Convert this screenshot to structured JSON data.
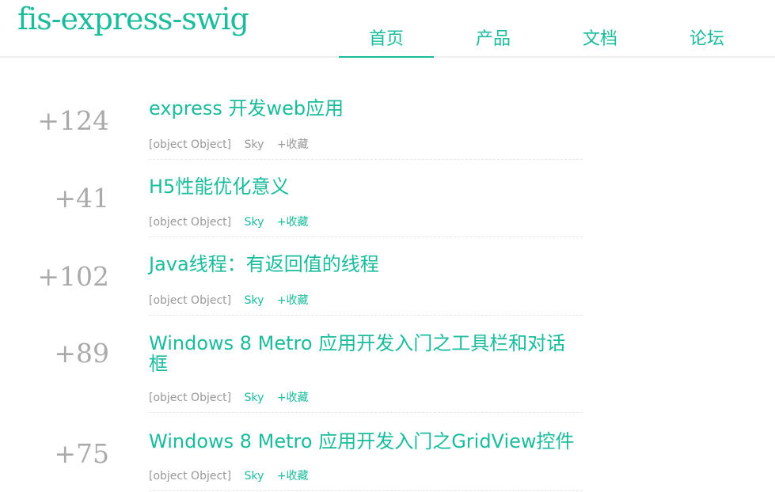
{
  "site": {
    "logo": "fis-express-swig"
  },
  "nav": {
    "items": [
      {
        "label": "首页"
      },
      {
        "label": "产品"
      },
      {
        "label": "文档"
      },
      {
        "label": "论坛"
      }
    ],
    "active_index": 0
  },
  "posts": [
    {
      "score": "+124",
      "title": "express 开发web应用",
      "category": "[object Object]",
      "author": "Sky",
      "fav": "+收藏"
    },
    {
      "score": "+41",
      "title": "H5性能优化意义",
      "category": "[object Object]",
      "author": "Sky",
      "fav": "+收藏"
    },
    {
      "score": "+102",
      "title": "Java线程：有返回值的线程",
      "category": "[object Object]",
      "author": "Sky",
      "fav": "+收藏"
    },
    {
      "score": "+89",
      "title": "Windows 8 Metro 应用开发入门之工具栏和对话框",
      "category": "[object Object]",
      "author": "Sky",
      "fav": "+收藏"
    },
    {
      "score": "+75",
      "title": "Windows 8 Metro 应用开发入门之GridView控件",
      "category": "[object Object]",
      "author": "Sky",
      "fav": "+收藏"
    }
  ],
  "colors": {
    "accent": "#1abc9c",
    "muted": "#999999",
    "score": "#aaaaaa"
  }
}
